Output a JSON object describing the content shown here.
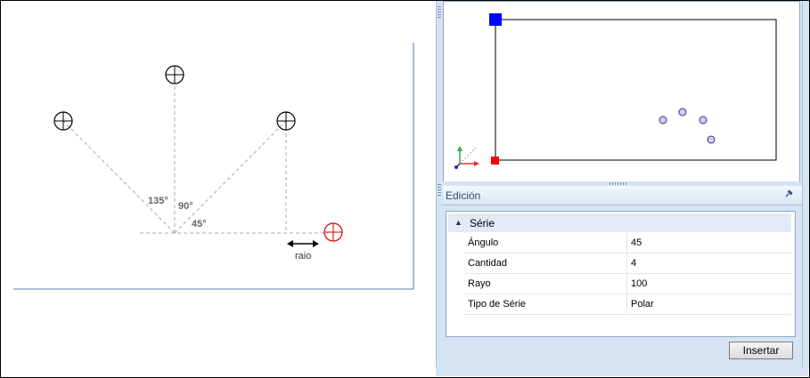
{
  "illustration": {
    "angles": [
      "135°",
      "90°",
      "45°"
    ],
    "radius_label": "raio"
  },
  "preview": {
    "icons": [
      "origin-square-icon",
      "corner-square-icon",
      "axis-gizmo-icon"
    ],
    "colors": {
      "top_marker": "#0000ff",
      "bottom_marker": "#ff0000"
    }
  },
  "edition_panel": {
    "title": "Edición",
    "pin_icon": "pin-icon",
    "category": "Série",
    "properties": [
      {
        "name": "Ángulo",
        "value": "45"
      },
      {
        "name": "Cantidad",
        "value": "4"
      },
      {
        "name": "Rayo",
        "value": "100"
      },
      {
        "name": "Tipo de Série",
        "value": "Polar"
      }
    ],
    "insert_button": "Insertar"
  }
}
